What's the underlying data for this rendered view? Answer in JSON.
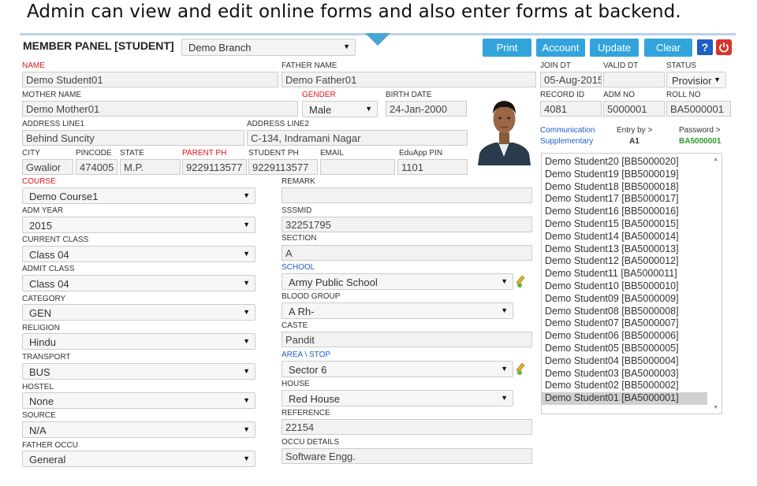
{
  "caption": "Admin can view and edit online forms and also enter forms at backend.",
  "panel": {
    "title": "MEMBER PANEL [STUDENT]",
    "branch": "Demo Branch"
  },
  "toolbar": {
    "print": "Print",
    "account": "Account",
    "update": "Update",
    "clear": "Clear",
    "help": "?"
  },
  "labels": {
    "name": "NAME",
    "father_name": "FATHER NAME",
    "join_dt": "JOIN DT",
    "valid_dt": "VALID DT",
    "status": "STATUS",
    "mother_name": "MOTHER NAME",
    "gender": "GENDER",
    "birth_date": "BIRTH DATE",
    "record_id": "RECORD ID",
    "adm_no": "ADM NO",
    "roll_no": "ROLL NO",
    "address1": "ADDRESS LINE1",
    "address2": "ADDRESS LINE2",
    "city": "CITY",
    "pincode": "PINCODE",
    "state": "STATE",
    "parent_ph": "PARENT PH",
    "student_ph": "STUDENT PH",
    "email": "EMAIL",
    "eduapp_pin": "EduApp PIN",
    "course": "COURSE",
    "remark": "REMARK",
    "adm_year": "ADM YEAR",
    "sssmid": "SSSMID",
    "current_class": "CURRENT CLASS",
    "section": "SECTION",
    "admit_class": "ADMIT CLASS",
    "school": "SCHOOL",
    "category": "CATEGORY",
    "blood_group": "BLOOD GROUP",
    "religion": "RELIGION",
    "caste": "CASTE",
    "transport": "TRANSPORT",
    "area_stop": "AREA \\ STOP",
    "hostel": "HOSTEL",
    "house": "HOUSE",
    "source": "SOURCE",
    "reference": "REFERENCE",
    "father_occu": "FATHER OCCU",
    "occu_details": "OCCU DETAILS"
  },
  "fields": {
    "name": "Demo Student01",
    "father_name": "Demo Father01",
    "join_dt": "05-Aug-2015",
    "valid_dt": "",
    "status": "Provisior",
    "mother_name": "Demo Mother01",
    "gender": "Male",
    "birth_date": "24-Jan-2000",
    "record_id": "4081",
    "adm_no": "5000001",
    "roll_no": "BA5000001",
    "address1": "Behind Suncity",
    "address2": "C-134, Indramani Nagar",
    "city": "Gwalior",
    "pincode": "474005",
    "state": "M.P.",
    "parent_ph": "9229113577",
    "student_ph": "9229113577",
    "email": "",
    "eduapp_pin": "1101",
    "course": "Demo Course1",
    "remark": "",
    "adm_year": "2015",
    "sssmid": "32251795",
    "current_class": "Class 04",
    "section": "A",
    "admit_class": "Class 04",
    "school": "Army Public School",
    "category": "GEN",
    "blood_group": "A Rh-",
    "religion": "Hindu",
    "caste": "Pandit",
    "transport": "BUS",
    "area_stop": "Sector 6",
    "hostel": "None",
    "house": "Red House",
    "source": "N/A",
    "reference": "22154",
    "father_occu": "General",
    "occu_details": "Software Engg."
  },
  "info": {
    "communication": "Communication",
    "supplementary": "Supplementary",
    "entry_by_label": "Entry by >",
    "entry_by_value": "A1",
    "password_label": "Password >",
    "password_value": "BA5000001"
  },
  "student_list": [
    "Demo Student20 [BB5000020]",
    "Demo Student19 [BB5000019]",
    "Demo Student18 [BB5000018]",
    "Demo Student17 [BB5000017]",
    "Demo Student16 [BB5000016]",
    "Demo Student15 [BA5000015]",
    "Demo Student14 [BA5000014]",
    "Demo Student13 [BA5000013]",
    "Demo Student12 [BA5000012]",
    "Demo Student11 [BA5000011]",
    "Demo Student10 [BB5000010]",
    "Demo Student09 [BA5000009]",
    "Demo Student08 [BB5000008]",
    "Demo Student07 [BA5000007]",
    "Demo Student06 [BB5000006]",
    "Demo Student05 [BB5000005]",
    "Demo Student04 [BB5000004]",
    "Demo Student03 [BA5000003]",
    "Demo Student02 [BB5000002]",
    "Demo Student01 [BA5000001]"
  ],
  "icons": {
    "caret": "caret-down-icon",
    "power": "power-icon",
    "edit": "edit-pencil-icon",
    "photo": "student-photo"
  },
  "colors": {
    "accent": "#33a4db",
    "required_label": "#e0161b",
    "link_label": "#1d5ec9",
    "password_value": "#2a9a2a"
  }
}
